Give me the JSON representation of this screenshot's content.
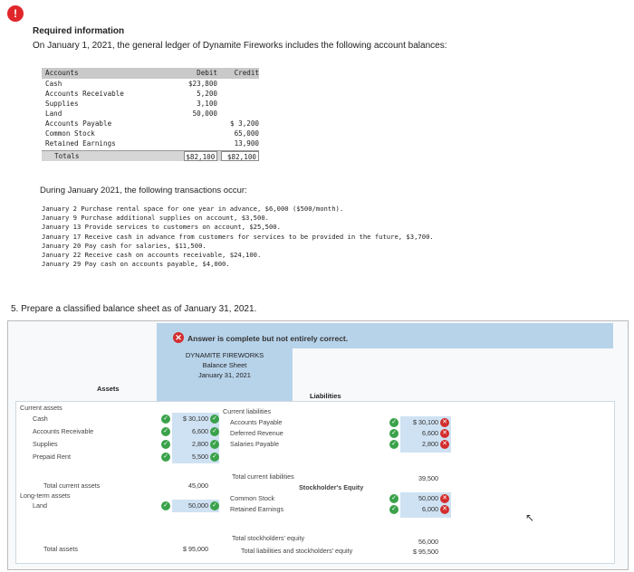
{
  "alert_glyph": "!",
  "required_title": "Required information",
  "intro": "On January 1, 2021, the general ledger of Dynamite Fireworks includes the following account balances:",
  "ledger": {
    "headers": [
      "Accounts",
      "Debit",
      "Credit"
    ],
    "rows": [
      [
        "Cash",
        "$23,800",
        ""
      ],
      [
        "Accounts Receivable",
        "5,200",
        ""
      ],
      [
        "Supplies",
        "3,100",
        ""
      ],
      [
        "Land",
        "50,000",
        ""
      ],
      [
        "Accounts Payable",
        "",
        "$ 3,200"
      ],
      [
        "Common Stock",
        "",
        "65,000"
      ],
      [
        "Retained Earnings",
        "",
        "13,900"
      ]
    ],
    "totals": [
      "Totals",
      "$82,100",
      "$82,100"
    ]
  },
  "transactions_intro": "During January 2021, the following transactions occur:",
  "transactions": [
    "January  2 Purchase rental space for one year in advance, $6,000 ($500/month).",
    "January  9 Purchase additional supplies on account, $3,500.",
    "January 13 Provide services to customers on account, $25,500.",
    "January 17 Receive cash in advance from customers for services to be provided in the future, $3,700.",
    "January 20 Pay cash for salaries, $11,500.",
    "January 22 Receive cash on accounts receivable, $24,100.",
    "January 29 Pay cash on accounts payable, $4,000."
  ],
  "question": "5. Prepare a classified balance sheet as of January 31, 2021.",
  "banner": "Answer is complete but not entirely correct.",
  "sheet": {
    "company": "DYNAMITE FIREWORKS",
    "title": "Balance Sheet",
    "date": "January 31, 2021",
    "assets_label": "Assets",
    "liabilities_label": "Liabilities",
    "current_assets": "Current assets",
    "cash": "Cash",
    "cash_amt": "$ 30,100",
    "ar": "Accounts Receivable",
    "ar_amt": "6,600",
    "supplies": "Supplies",
    "supplies_amt": "2,800",
    "prepaid": "Prepaid Rent",
    "prepaid_amt": "5,500",
    "total_current_assets": "Total current assets",
    "tca_amt": "45,000",
    "long_term": "Long-term assets",
    "land": "Land",
    "land_amt": "50,000",
    "total_assets": "Total assets",
    "ta_amt": "$ 95,000",
    "current_liab": "Current liabilities",
    "ap": "Accounts Payable",
    "ap_amt": "$ 30,100",
    "deferred": "Deferred Revenue",
    "deferred_amt": "6,600",
    "salaries": "Salaries Payable",
    "salaries_amt": "2,800",
    "total_current_liab": "Total current liabilities",
    "tcl_amt": "39,500",
    "equity_label": "Stockholder's Equity",
    "common": "Common Stock",
    "common_amt": "50,000",
    "retained": "Retained Earnings",
    "retained_amt": "6,000",
    "total_equity": "Total stockholders' equity",
    "te_amt": "56,000",
    "total_le": "Total liabilities and stockholders' equity",
    "tle_amt": "$ 95,500"
  },
  "icons": {
    "check": "✓",
    "cross": "✕"
  }
}
